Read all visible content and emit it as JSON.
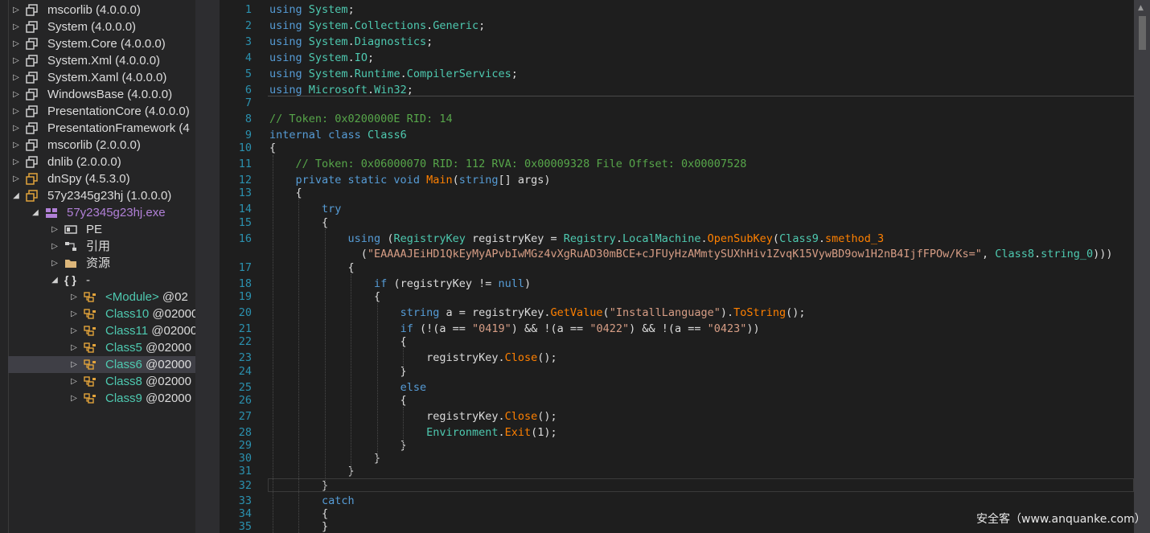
{
  "tree": [
    {
      "name": "mscorlib",
      "ver": "(4.0.0.0)",
      "depth": 0,
      "arrow": "▷",
      "icon": "assembly-icon"
    },
    {
      "name": "System",
      "ver": "(4.0.0.0)",
      "depth": 0,
      "arrow": "▷",
      "icon": "assembly-icon"
    },
    {
      "name": "System.Core",
      "ver": "(4.0.0.0)",
      "depth": 0,
      "arrow": "▷",
      "icon": "assembly-icon"
    },
    {
      "name": "System.Xml",
      "ver": "(4.0.0.0)",
      "depth": 0,
      "arrow": "▷",
      "icon": "assembly-icon"
    },
    {
      "name": "System.Xaml",
      "ver": "(4.0.0.0)",
      "depth": 0,
      "arrow": "▷",
      "icon": "assembly-icon"
    },
    {
      "name": "WindowsBase",
      "ver": "(4.0.0.0)",
      "depth": 0,
      "arrow": "▷",
      "icon": "assembly-icon"
    },
    {
      "name": "PresentationCore",
      "ver": "(4.0.0.0)",
      "depth": 0,
      "arrow": "▷",
      "icon": "assembly-icon"
    },
    {
      "name": "PresentationFramework",
      "ver": "(4",
      "depth": 0,
      "arrow": "▷",
      "icon": "assembly-icon"
    },
    {
      "name": "mscorlib",
      "ver": "(2.0.0.0)",
      "depth": 0,
      "arrow": "▷",
      "icon": "assembly-icon"
    },
    {
      "name": "dnlib",
      "ver": "(2.0.0.0)",
      "depth": 0,
      "arrow": "▷",
      "icon": "assembly-icon"
    },
    {
      "name": "dnSpy",
      "ver": "(4.5.3.0)",
      "depth": 0,
      "arrow": "▷",
      "icon": "assembly-orange-icon"
    },
    {
      "name": "57y2345g23hj",
      "ver": "(1.0.0.0)",
      "depth": 0,
      "arrow": "◢",
      "icon": "assembly-orange-icon"
    },
    {
      "name": "57y2345g23hj.exe",
      "ver": "",
      "depth": 1,
      "arrow": "◢",
      "icon": "module-icon",
      "color": "#b180d7"
    },
    {
      "name": "PE",
      "ver": "",
      "depth": 2,
      "arrow": "▷",
      "icon": "pe-icon"
    },
    {
      "name": "引用",
      "ver": "",
      "depth": 2,
      "arrow": "▷",
      "icon": "references-icon"
    },
    {
      "name": "资源",
      "ver": "",
      "depth": 2,
      "arrow": "▷",
      "icon": "folder-icon"
    },
    {
      "name": "-",
      "ver": "",
      "depth": 2,
      "arrow": "◢",
      "icon": "namespace-icon"
    },
    {
      "name": "<Module>",
      "ver": "@02",
      "depth": 3,
      "arrow": "▷",
      "icon": "class-icon",
      "color": "#4ec9b0"
    },
    {
      "name": "Class10",
      "ver": "@02000",
      "depth": 3,
      "arrow": "▷",
      "icon": "class-icon",
      "color": "#4ec9b0"
    },
    {
      "name": "Class11",
      "ver": "@02000",
      "depth": 3,
      "arrow": "▷",
      "icon": "class-icon",
      "color": "#4ec9b0"
    },
    {
      "name": "Class5",
      "ver": "@02000",
      "depth": 3,
      "arrow": "▷",
      "icon": "class-icon",
      "color": "#4ec9b0"
    },
    {
      "name": "Class6",
      "ver": "@02000",
      "depth": 3,
      "arrow": "▷",
      "icon": "class-icon",
      "color": "#4ec9b0",
      "selected": true
    },
    {
      "name": "Class8",
      "ver": "@02000",
      "depth": 3,
      "arrow": "▷",
      "icon": "class-icon",
      "color": "#4ec9b0"
    },
    {
      "name": "Class9",
      "ver": "@02000",
      "depth": 3,
      "arrow": "▷",
      "icon": "class-icon",
      "color": "#4ec9b0"
    }
  ],
  "editor": {
    "lines": [
      {
        "n": "1",
        "t": [
          [
            "kw",
            "using"
          ],
          [
            "pl",
            " "
          ],
          [
            "ty",
            "System"
          ],
          [
            "pl",
            ";"
          ]
        ]
      },
      {
        "n": "2",
        "t": [
          [
            "kw",
            "using"
          ],
          [
            "pl",
            " "
          ],
          [
            "ty",
            "System"
          ],
          [
            "pl",
            "."
          ],
          [
            "ty",
            "Collections"
          ],
          [
            "pl",
            "."
          ],
          [
            "ty",
            "Generic"
          ],
          [
            "pl",
            ";"
          ]
        ]
      },
      {
        "n": "3",
        "t": [
          [
            "kw",
            "using"
          ],
          [
            "pl",
            " "
          ],
          [
            "ty",
            "System"
          ],
          [
            "pl",
            "."
          ],
          [
            "ty",
            "Diagnostics"
          ],
          [
            "pl",
            ";"
          ]
        ]
      },
      {
        "n": "4",
        "t": [
          [
            "kw",
            "using"
          ],
          [
            "pl",
            " "
          ],
          [
            "ty",
            "System"
          ],
          [
            "pl",
            "."
          ],
          [
            "ty",
            "IO"
          ],
          [
            "pl",
            ";"
          ]
        ]
      },
      {
        "n": "5",
        "t": [
          [
            "kw",
            "using"
          ],
          [
            "pl",
            " "
          ],
          [
            "ty",
            "System"
          ],
          [
            "pl",
            "."
          ],
          [
            "ty",
            "Runtime"
          ],
          [
            "pl",
            "."
          ],
          [
            "ty",
            "CompilerServices"
          ],
          [
            "pl",
            ";"
          ]
        ]
      },
      {
        "n": "6",
        "t": [
          [
            "kw",
            "using"
          ],
          [
            "pl",
            " "
          ],
          [
            "ty",
            "Microsoft"
          ],
          [
            "pl",
            "."
          ],
          [
            "ty",
            "Win32"
          ],
          [
            "pl",
            ";"
          ]
        ]
      },
      {
        "n": "7",
        "t": []
      },
      {
        "n": "8",
        "t": [
          [
            "cm",
            "// Token: 0x0200000E RID: 14"
          ]
        ]
      },
      {
        "n": "9",
        "t": [
          [
            "kw",
            "internal class"
          ],
          [
            "pl",
            " "
          ],
          [
            "ty",
            "Class6"
          ]
        ]
      },
      {
        "n": "10",
        "t": [
          [
            "pl",
            "{"
          ]
        ]
      },
      {
        "n": "11",
        "t": [
          [
            "pl",
            "    "
          ],
          [
            "cm",
            "// Token: 0x06000070 RID: 112 RVA: 0x00009328 File Offset: 0x00007528"
          ]
        ]
      },
      {
        "n": "12",
        "t": [
          [
            "pl",
            "    "
          ],
          [
            "kw",
            "private static void"
          ],
          [
            "pl",
            " "
          ],
          [
            "mt",
            "Main"
          ],
          [
            "pl",
            "("
          ],
          [
            "kw",
            "string"
          ],
          [
            "pl",
            "[] args)"
          ]
        ]
      },
      {
        "n": "13",
        "t": [
          [
            "pl",
            "    {"
          ]
        ]
      },
      {
        "n": "14",
        "t": [
          [
            "pl",
            "        "
          ],
          [
            "kw",
            "try"
          ]
        ]
      },
      {
        "n": "15",
        "t": [
          [
            "pl",
            "        {"
          ]
        ]
      },
      {
        "n": "16",
        "t": [
          [
            "pl",
            "            "
          ],
          [
            "kw",
            "using"
          ],
          [
            "pl",
            " ("
          ],
          [
            "ty",
            "RegistryKey"
          ],
          [
            "pl",
            " registryKey = "
          ],
          [
            "ty",
            "Registry"
          ],
          [
            "pl",
            "."
          ],
          [
            "ty",
            "LocalMachine"
          ],
          [
            "pl",
            "."
          ],
          [
            "mt",
            "OpenSubKey"
          ],
          [
            "pl",
            "("
          ],
          [
            "ty",
            "Class9"
          ],
          [
            "pl",
            "."
          ],
          [
            "mt",
            "smethod_3"
          ]
        ]
      },
      {
        "n": "",
        "t": [
          [
            "pl",
            "              ("
          ],
          [
            "st",
            "\"EAAAAJEiHD1QkEyMyAPvbIwMGz4vXgRuAD30mBCE+cJFUyHzAMmtySUXhHiv1ZvqK15VywBD9ow1H2nB4IjfFPOw/Ks=\""
          ],
          [
            "pl",
            ", "
          ],
          [
            "ty",
            "Class8"
          ],
          [
            "pl",
            "."
          ],
          [
            "ty",
            "string_0"
          ],
          [
            "pl",
            ")))"
          ]
        ]
      },
      {
        "n": "17",
        "t": [
          [
            "pl",
            "            {"
          ]
        ]
      },
      {
        "n": "18",
        "t": [
          [
            "pl",
            "                "
          ],
          [
            "kw",
            "if"
          ],
          [
            "pl",
            " (registryKey != "
          ],
          [
            "kw",
            "null"
          ],
          [
            "pl",
            ")"
          ]
        ]
      },
      {
        "n": "19",
        "t": [
          [
            "pl",
            "                {"
          ]
        ]
      },
      {
        "n": "20",
        "t": [
          [
            "pl",
            "                    "
          ],
          [
            "kw",
            "string"
          ],
          [
            "pl",
            " a = registryKey."
          ],
          [
            "mt",
            "GetValue"
          ],
          [
            "pl",
            "("
          ],
          [
            "st",
            "\"InstallLanguage\""
          ],
          [
            "pl",
            ")."
          ],
          [
            "mt",
            "ToString"
          ],
          [
            "pl",
            "();"
          ]
        ]
      },
      {
        "n": "21",
        "t": [
          [
            "pl",
            "                    "
          ],
          [
            "kw",
            "if"
          ],
          [
            "pl",
            " (!(a == "
          ],
          [
            "st",
            "\"0419\""
          ],
          [
            "pl",
            ") && !(a == "
          ],
          [
            "st",
            "\"0422\""
          ],
          [
            "pl",
            ") && !(a == "
          ],
          [
            "st",
            "\"0423\""
          ],
          [
            "pl",
            "))"
          ]
        ]
      },
      {
        "n": "22",
        "t": [
          [
            "pl",
            "                    {"
          ]
        ]
      },
      {
        "n": "23",
        "t": [
          [
            "pl",
            "                        registryKey."
          ],
          [
            "mt",
            "Close"
          ],
          [
            "pl",
            "();"
          ]
        ]
      },
      {
        "n": "24",
        "t": [
          [
            "pl",
            "                    }"
          ]
        ]
      },
      {
        "n": "25",
        "t": [
          [
            "pl",
            "                    "
          ],
          [
            "kw",
            "else"
          ]
        ]
      },
      {
        "n": "26",
        "t": [
          [
            "pl",
            "                    {"
          ]
        ]
      },
      {
        "n": "27",
        "t": [
          [
            "pl",
            "                        registryKey."
          ],
          [
            "mt",
            "Close"
          ],
          [
            "pl",
            "();"
          ]
        ]
      },
      {
        "n": "28",
        "t": [
          [
            "pl",
            "                        "
          ],
          [
            "ty",
            "Environment"
          ],
          [
            "pl",
            "."
          ],
          [
            "mt",
            "Exit"
          ],
          [
            "pl",
            "(1);"
          ]
        ]
      },
      {
        "n": "29",
        "t": [
          [
            "pl",
            "                    }"
          ]
        ]
      },
      {
        "n": "30",
        "t": [
          [
            "pl",
            "                }"
          ]
        ]
      },
      {
        "n": "31",
        "t": [
          [
            "pl",
            "            }"
          ]
        ]
      },
      {
        "n": "32",
        "t": [
          [
            "pl",
            "        }"
          ]
        ]
      },
      {
        "n": "33",
        "t": [
          [
            "pl",
            "        "
          ],
          [
            "kw",
            "catch"
          ]
        ]
      },
      {
        "n": "34",
        "t": [
          [
            "pl",
            "        {"
          ]
        ]
      },
      {
        "n": "35",
        "t": [
          [
            "pl",
            "        }"
          ]
        ]
      }
    ]
  },
  "watermark": "安全客（www.anquanke.com）"
}
